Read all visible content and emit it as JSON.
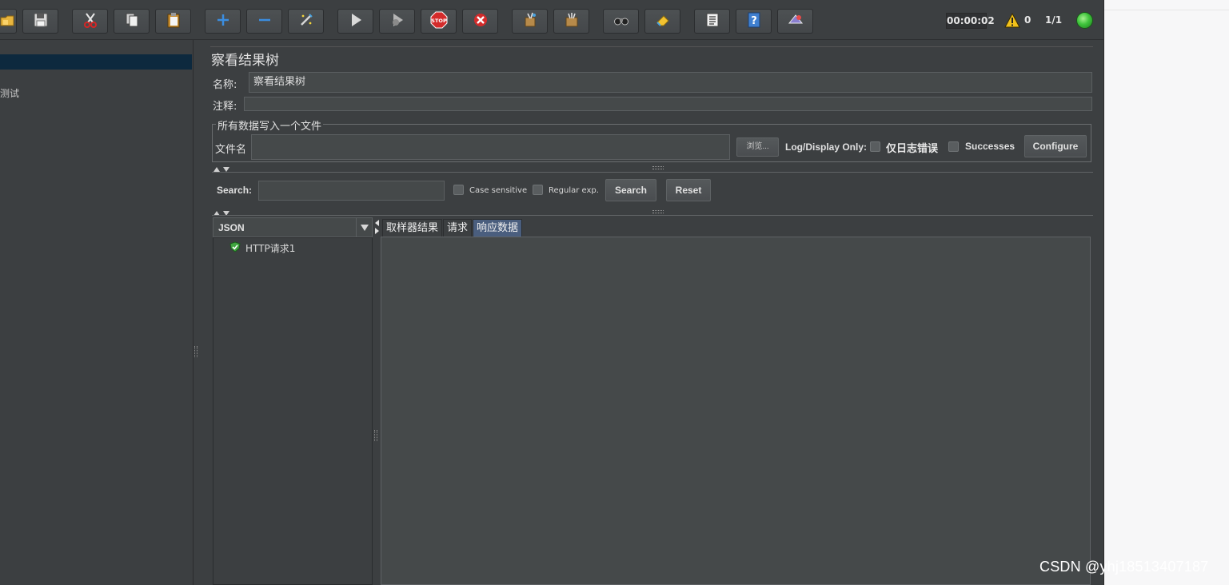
{
  "toolbar": {
    "buttons": [
      {
        "name": "open-button",
        "icon": "folder-icon"
      },
      {
        "name": "save-button",
        "icon": "save-icon"
      },
      {
        "name": "cut-button",
        "icon": "scissors-icon"
      },
      {
        "name": "copy-button",
        "icon": "copy-icon"
      },
      {
        "name": "paste-button",
        "icon": "paste-icon"
      },
      {
        "name": "expand-button",
        "icon": "plus-icon"
      },
      {
        "name": "collapse-button",
        "icon": "minus-icon"
      },
      {
        "name": "toggle-button",
        "icon": "wand-icon"
      },
      {
        "name": "start-button",
        "icon": "play-icon"
      },
      {
        "name": "start-no-pause-button",
        "icon": "play-timer-icon"
      },
      {
        "name": "stop-button",
        "icon": "stop-icon"
      },
      {
        "name": "shutdown-button",
        "icon": "shutdown-icon"
      },
      {
        "name": "clear-button",
        "icon": "broom-icon"
      },
      {
        "name": "clear-all-button",
        "icon": "broom-all-icon"
      },
      {
        "name": "search-button",
        "icon": "binoculars-icon"
      },
      {
        "name": "reset-search-button",
        "icon": "eraser-icon"
      },
      {
        "name": "function-helper-button",
        "icon": "list-icon"
      },
      {
        "name": "help-button",
        "icon": "help-icon"
      },
      {
        "name": "remote-button",
        "icon": "remote-icon"
      }
    ],
    "timer": "00:00:02",
    "error_count": "0",
    "threads": "1/1",
    "status_color": "#3fc43c"
  },
  "left_tree": {
    "item_label": "测试"
  },
  "panel": {
    "title": "察看结果树",
    "name_label": "名称:",
    "name_value": "察看结果树",
    "comment_label": "注释:",
    "comment_value": "",
    "file_group_title": "所有数据写入一个文件",
    "filename_label": "文件名",
    "filename_value": "",
    "browse_label": "浏览...",
    "log_display_label": "Log/Display Only:",
    "errors_label": "仅日志错误",
    "successes_label": "Successes",
    "configure_label": "Configure"
  },
  "search": {
    "label": "Search:",
    "value": "",
    "case_sensitive_label": "Case sensitive",
    "regex_label": "Regular exp.",
    "search_button": "Search",
    "reset_button": "Reset"
  },
  "results": {
    "renderer": "JSON",
    "tree_items": [
      {
        "label": "HTTP请求1",
        "status": "success"
      }
    ],
    "tabs": [
      {
        "label": "取样器结果",
        "active": false
      },
      {
        "label": "请求",
        "active": false
      },
      {
        "label": "响应数据",
        "active": true
      }
    ]
  },
  "watermark": "CSDN @yhj18513407187",
  "colors": {
    "background": "#3c3f41",
    "active_tab": "#4a5e7e",
    "selection": "#0d293e"
  }
}
